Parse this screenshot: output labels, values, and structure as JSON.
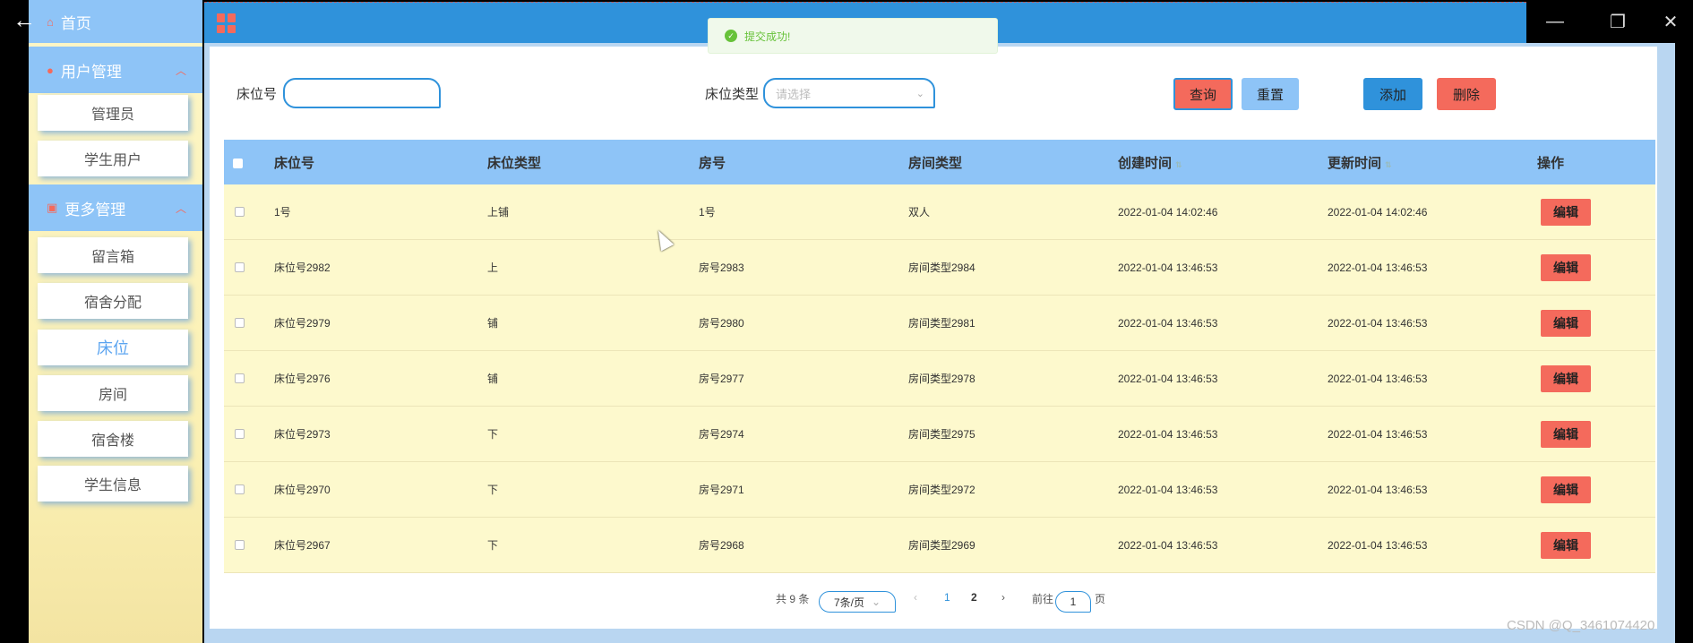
{
  "sidebar": {
    "home": "首页",
    "groups": [
      {
        "label": "用户管理",
        "items": [
          "管理员",
          "学生用户"
        ]
      },
      {
        "label": "更多管理",
        "items": [
          "留言箱",
          "宿舍分配",
          "床位",
          "房间",
          "宿舍楼",
          "学生信息"
        ]
      }
    ]
  },
  "toast": {
    "message": "提交成功!"
  },
  "search": {
    "bed_no_label": "床位号",
    "bed_type_label": "床位类型",
    "bed_type_placeholder": "请选择",
    "query": "查询",
    "reset": "重置",
    "add": "添加",
    "delete": "删除"
  },
  "table": {
    "columns": [
      "床位号",
      "床位类型",
      "房号",
      "房间类型",
      "创建时间",
      "更新时间",
      "操作"
    ],
    "edit_label": "编辑",
    "rows": [
      [
        "1号",
        "上铺",
        "1号",
        "双人",
        "2022-01-04 14:02:46",
        "2022-01-04 14:02:46"
      ],
      [
        "床位号2982",
        "上",
        "房号2983",
        "房间类型2984",
        "2022-01-04 13:46:53",
        "2022-01-04 13:46:53"
      ],
      [
        "床位号2979",
        "铺",
        "房号2980",
        "房间类型2981",
        "2022-01-04 13:46:53",
        "2022-01-04 13:46:53"
      ],
      [
        "床位号2976",
        "铺",
        "房号2977",
        "房间类型2978",
        "2022-01-04 13:46:53",
        "2022-01-04 13:46:53"
      ],
      [
        "床位号2973",
        "下",
        "房号2974",
        "房间类型2975",
        "2022-01-04 13:46:53",
        "2022-01-04 13:46:53"
      ],
      [
        "床位号2970",
        "下",
        "房号2971",
        "房间类型2972",
        "2022-01-04 13:46:53",
        "2022-01-04 13:46:53"
      ],
      [
        "床位号2967",
        "下",
        "房号2968",
        "房间类型2969",
        "2022-01-04 13:46:53",
        "2022-01-04 13:46:53"
      ]
    ]
  },
  "pagination": {
    "total": "共 9 条",
    "page_size": "7条/页",
    "pages": [
      "1",
      "2"
    ],
    "goto_label": "前往",
    "goto_value": "1",
    "page_suffix": "页"
  },
  "colors": {
    "primary": "#2f92db",
    "light_blue": "#8ec4f7",
    "danger": "#f46a5c",
    "row_bg": "#fdf9cd",
    "sidebar_bg": "#fdf6c7",
    "success": "#67c23a"
  },
  "watermark": "CSDN @Q_3461074420"
}
